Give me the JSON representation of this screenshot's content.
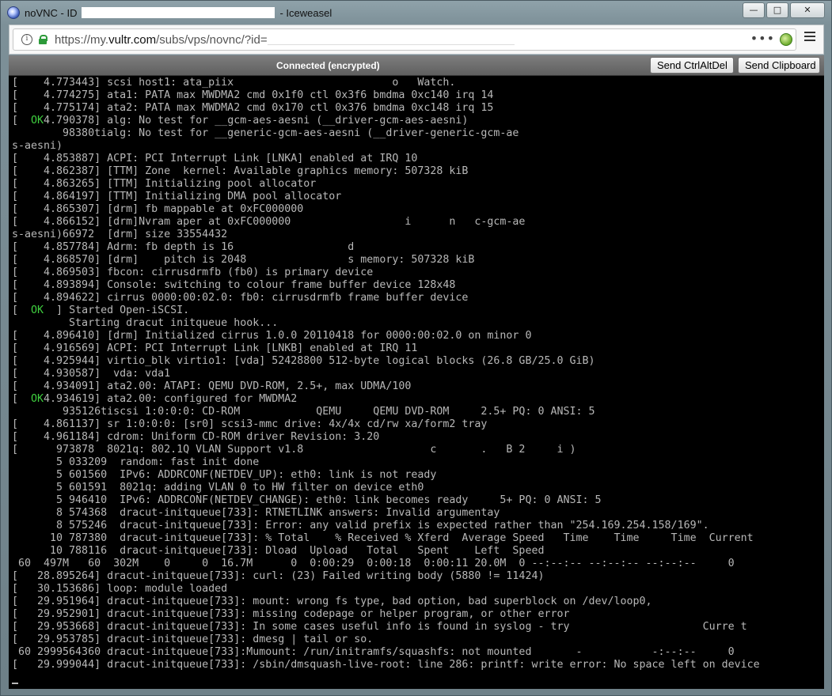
{
  "window": {
    "title_prefix": "noVNC - ID",
    "title_suffix": "- Iceweasel",
    "controls": {
      "minimize": "—",
      "maximize": "□",
      "close": "✕"
    }
  },
  "browser": {
    "url_prefix": "https://my.",
    "url_host": "vultr.com",
    "url_path": "/subs/vps/novnc/?id=",
    "more": "•••"
  },
  "novnc": {
    "status": "Connected (encrypted)",
    "send_ctrl_alt_del": "Send CtrlAltDel",
    "send_clipboard": "Send Clipboard"
  },
  "console": {
    "lines": [
      [
        "[    4.773443] scsi host1: ata_piix                         o   Watch."
      ],
      [
        "[    4.774275] ata1: PATA max MWDMA2 cmd 0x1f0 ctl 0x3f6 bmdma 0xc140 irq 14"
      ],
      [
        "[    4.775174] ata2: PATA max MWDMA2 cmd 0x170 ctl 0x376 bmdma 0xc148 irq 15"
      ],
      [
        "[  ",
        "OK",
        "4.790378] alg: No test for __gcm-aes-aesni (__driver-gcm-aes-aesni)"
      ],
      [
        "        98380tialg: No test for __generic-gcm-aes-aesni (__driver-generic-gcm-ae"
      ],
      [
        "s-aesni)"
      ],
      [
        "[    4.853887] ACPI: PCI Interrupt Link [LNKA] enabled at IRQ 10"
      ],
      [
        "[    4.862387] [TTM] Zone  kernel: Available graphics memory: 507328 kiB"
      ],
      [
        "[    4.863265] [TTM] Initializing pool allocator"
      ],
      [
        "[    4.864197] [TTM] Initializing DMA pool allocator"
      ],
      [
        "[    4.865307] [drm] fb mappable at 0xFC000000"
      ],
      [
        "[    4.866152] [drm]Nvram aper at 0xFC000000                  i      n   c-gcm-ae"
      ],
      [
        "s-aesni)66972  [drm] size 33554432"
      ],
      [
        "[    4.857784] Adrm: fb depth is 16                  d"
      ],
      [
        "[    4.868570] [drm]    pitch is 2048                s memory: 507328 kiB"
      ],
      [
        "[    4.869503] fbcon: cirrusdrmfb (fb0) is primary device"
      ],
      [
        "[    4.893894] Console: switching to colour frame buffer device 128x48"
      ],
      [
        "[    4.894622] cirrus 0000:00:02.0: fb0: cirrusdrmfb frame buffer device"
      ],
      [
        "[  ",
        "OK",
        "  ] Started Open-iSCSI."
      ],
      [
        "         Starting dracut initqueue hook..."
      ],
      [
        "[    4.896410] [drm] Initialized cirrus 1.0.0 20110418 for 0000:00:02.0 on minor 0"
      ],
      [
        "[    4.916569] ACPI: PCI Interrupt Link [LNKB] enabled at IRQ 11"
      ],
      [
        "[    4.925944] virtio_blk virtio1: [vda] 52428800 512-byte logical blocks (26.8 GB/25.0 GiB)"
      ],
      [
        "[    4.930587]  vda: vda1"
      ],
      [
        "[    4.934091] ata2.00: ATAPI: QEMU DVD-ROM, 2.5+, max UDMA/100"
      ],
      [
        "[  ",
        "OK",
        "4.934619] ata2.00: configured for MWDMA2"
      ],
      [
        "        935126tiscsi 1:0:0:0: CD-ROM            QEMU     QEMU DVD-ROM     2.5+ PQ: 0 ANSI: 5"
      ],
      [
        "[    4.861137] sr 1:0:0:0: [sr0] scsi3-mmc drive: 4x/4x cd/rw xa/form2 tray"
      ],
      [
        "[    4.961184] cdrom: Uniform CD-ROM driver Revision: 3.20"
      ],
      [
        "[      973878  8021q: 802.1Q VLAN Support v1.8                    c       .   B 2     i )"
      ],
      [
        "       5 033209  random: fast init done"
      ],
      [
        "       5 601560  IPv6: ADDRCONF(NETDEV_UP): eth0: link is not ready"
      ],
      [
        "       5 601591  8021q: adding VLAN 0 to HW filter on device eth0"
      ],
      [
        "       5 946410  IPv6: ADDRCONF(NETDEV_CHANGE): eth0: link becomes ready     5+ PQ: 0 ANSI: 5"
      ],
      [
        "       8 574368  dracut-initqueue[733]: RTNETLINK answers: Invalid argumentay"
      ],
      [
        "       8 575246  dracut-initqueue[733]: Error: any valid prefix is expected rather than \"254.169.254.158/169\"."
      ],
      [
        "      10 787380  dracut-initqueue[733]: % Total    % Received % Xferd  Average Speed   Time    Time     Time  Current"
      ],
      [
        "      10 788116  dracut-initqueue[733]: Dload  Upload   Total   Spent    Left  Speed"
      ],
      [
        " 60  497M   60  302M    0     0  16.7M      0  0:00:29  0:00:18  0:00:11 20.0M  0 --:--:-- --:--:-- --:--:--     0"
      ],
      [
        "[   28.895264] dracut-initqueue[733]: curl: (23) Failed writing body (5880 != 11424)"
      ],
      [
        "[   30.153686] loop: module loaded"
      ],
      [
        "[   29.951964] dracut-initqueue[733]: mount: wrong fs type, bad option, bad superblock on /dev/loop0,"
      ],
      [
        "[   29.952901] dracut-initqueue[733]: missing codepage or helper program, or other error"
      ],
      [
        "[   29.953668] dracut-initqueue[733]: In some cases useful info is found in syslog - try                     Curre t"
      ],
      [
        "[   29.953785] dracut-initqueue[733]: dmesg | tail or so."
      ],
      [
        " 60 2999564360 dracut-initqueue[733]:Mumount: /run/initramfs/squashfs: not mounted       -           -:--:--     0"
      ],
      [
        "[   29.999044] dracut-initqueue[733]: /sbin/dmsquash-live-root: line 286: printf: write error: No space left on device"
      ],
      [
        ""
      ]
    ]
  }
}
